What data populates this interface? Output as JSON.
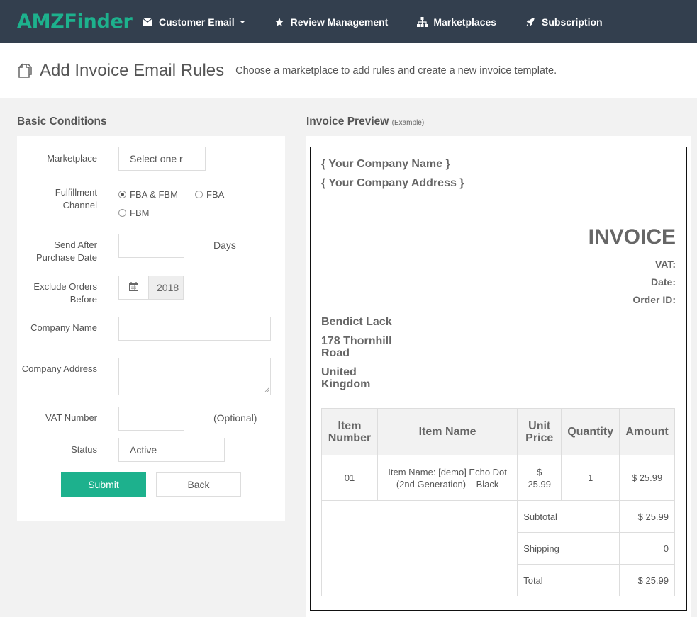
{
  "nav": {
    "brand": "AMZFinder",
    "items": [
      {
        "label": "Customer Email",
        "icon": "envelope-icon",
        "dropdown": true
      },
      {
        "label": "Review Management",
        "icon": "star-icon"
      },
      {
        "label": "Marketplaces",
        "icon": "sitemap-icon"
      },
      {
        "label": "Subscription",
        "icon": "rocket-icon"
      }
    ]
  },
  "header": {
    "title": "Add Invoice Email Rules",
    "subtitle": "Choose a marketplace to add rules and create a new invoice template."
  },
  "basic": {
    "title": "Basic Conditions",
    "marketplace_label": "Marketplace",
    "marketplace_value": "Select one r",
    "fulfillment_label": "Fulfillment Channel",
    "fulfillment_options": [
      "FBA & FBM",
      "FBA",
      "FBM"
    ],
    "fulfillment_selected": "FBA & FBM",
    "send_after_label": "Send After Purchase Date",
    "send_after_value": "",
    "send_after_unit": "Days",
    "exclude_label": "Exclude Orders Before",
    "exclude_value": "2018",
    "company_name_label": "Company Name",
    "company_name_value": "",
    "company_address_label": "Company Address",
    "company_address_value": "",
    "vat_label": "VAT Number",
    "vat_value": "",
    "vat_note": "(Optional)",
    "status_label": "Status",
    "status_value": "Active",
    "submit_label": "Submit",
    "back_label": "Back"
  },
  "preview": {
    "title": "Invoice Preview",
    "title_note": "(Example)",
    "company_name": "{ Your Company Name }",
    "company_address": "{ Your Company Address }",
    "heading": "INVOICE",
    "vat": "VAT:",
    "date": "Date:",
    "order_id": "Order ID:",
    "customer_name": "Bendict Lack",
    "address_line1": "178 Thornhill",
    "address_line2": "Road",
    "country_line1": "United",
    "country_line2": "Kingdom",
    "table": {
      "headers": [
        "Item Number",
        "Item Name",
        "Unit Price",
        "Quantity",
        "Amount"
      ],
      "row": {
        "number": "01",
        "name": "Item Name: [demo] Echo Dot (2nd Generation) – Black",
        "unit_price": "$ 25.99",
        "quantity": "1",
        "amount": "$ 25.99"
      },
      "subtotal_label": "Subtotal",
      "subtotal": "$ 25.99",
      "shipping_label": "Shipping",
      "shipping": "0",
      "total_label": "Total",
      "total": "$ 25.99"
    }
  },
  "colors": {
    "accent": "#1db18d",
    "navbar": "#333f4e"
  }
}
